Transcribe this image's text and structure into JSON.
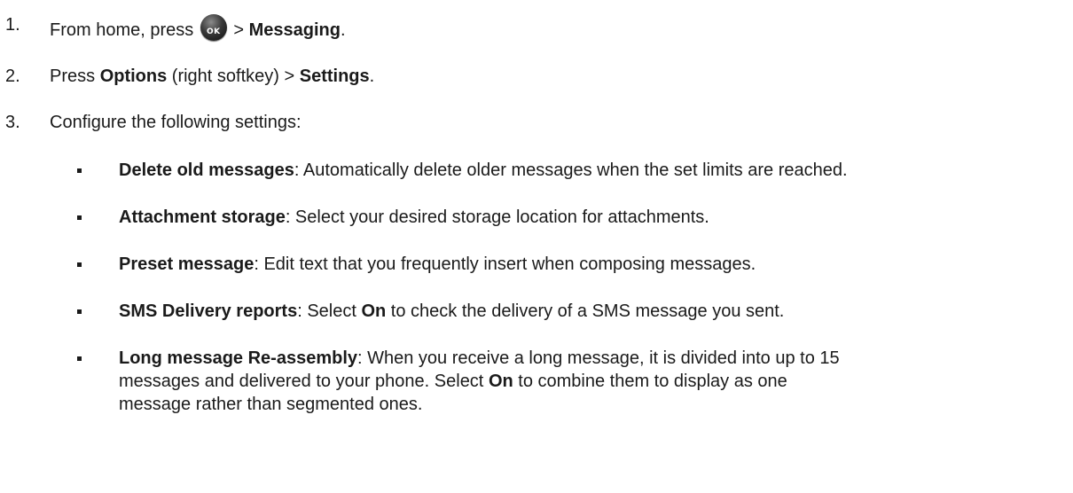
{
  "steps": [
    {
      "number": "1.",
      "prefix": "From home, press",
      "sep": " > ",
      "bold": "Messaging",
      "suffix": "."
    },
    {
      "number": "2.",
      "prefix": "Press ",
      "bold1": "Options",
      "middle": " (right softkey) > ",
      "bold2": "Settings",
      "suffix": "."
    },
    {
      "number": "3.",
      "text": "Configure the following settings:"
    }
  ],
  "icons": {
    "ok_key": {
      "name": "ok-key-icon",
      "label": "OK"
    }
  },
  "settings": [
    {
      "term": "Delete old messages",
      "desc": ": Automatically delete older messages when the set limits are reached."
    },
    {
      "term": "Attachment storage",
      "desc": ": Select your desired storage location for attachments."
    },
    {
      "term": "Preset message",
      "desc": ": Edit text that you frequently insert when composing messages."
    },
    {
      "term": "SMS Delivery reports",
      "desc1": ": Select ",
      "on": "On",
      "desc2": " to check the delivery of a SMS message you sent."
    },
    {
      "term": "Long message Re-assembly",
      "desc_line1": ": When you receive a long message, it is divided into up to 15",
      "desc_line2a": "messages and delivered to your phone. Select ",
      "on": "On",
      "desc_line2b": " to combine them to display as one",
      "desc_line3": "message rather than segmented ones."
    }
  ]
}
